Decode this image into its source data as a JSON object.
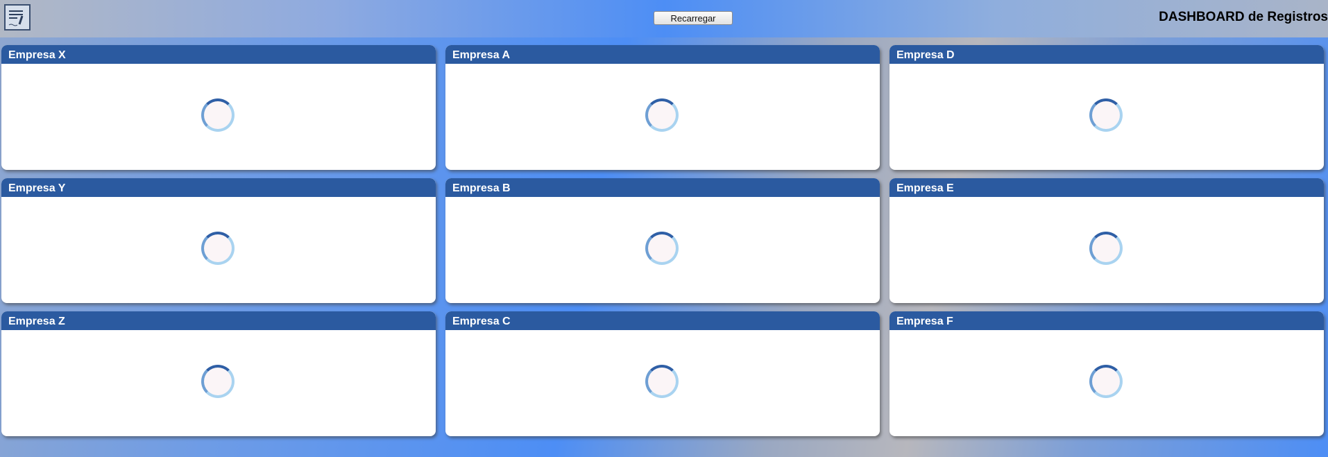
{
  "header": {
    "logo": "document-lines-icon",
    "reload_label": "Recarregar",
    "title": "DASHBOARD de Registros"
  },
  "cards": [
    {
      "name": "Empresa X",
      "state": "loading"
    },
    {
      "name": "Empresa A",
      "state": "loading"
    },
    {
      "name": "Empresa D",
      "state": "loading"
    },
    {
      "name": "Empresa Y",
      "state": "loading"
    },
    {
      "name": "Empresa B",
      "state": "loading"
    },
    {
      "name": "Empresa E",
      "state": "loading"
    },
    {
      "name": "Empresa Z",
      "state": "loading"
    },
    {
      "name": "Empresa C",
      "state": "loading"
    },
    {
      "name": "Empresa F",
      "state": "loading"
    }
  ],
  "colors": {
    "card_header": "#2b5aa0",
    "accent": "#4d8ef5"
  }
}
